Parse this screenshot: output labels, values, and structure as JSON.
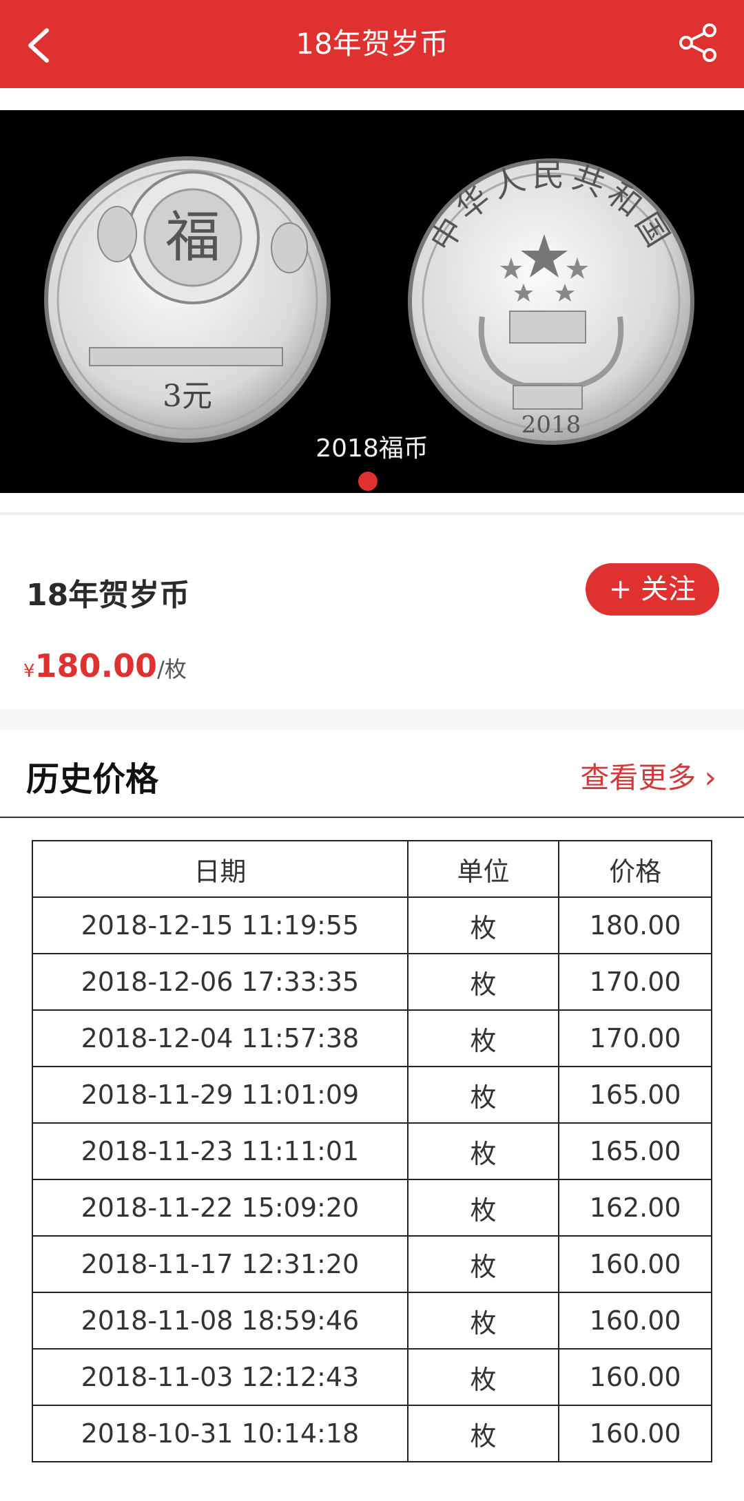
{
  "header": {
    "title": "18年贺岁币",
    "back_icon": "chevron-left-icon",
    "share_icon": "share-icon"
  },
  "banner": {
    "caption": "2018福币",
    "coin_front": {
      "fu_character": "福",
      "denomination": "3元"
    },
    "coin_back": {
      "inscription": "中华人民共和国",
      "year": "2018"
    }
  },
  "product": {
    "name": "18年贺岁币",
    "follow_label": "+ 关注",
    "currency": "¥",
    "price": "180.00",
    "unit": "/枚"
  },
  "history": {
    "title": "历史价格",
    "more_label": "查看更多",
    "columns": [
      "日期",
      "单位",
      "价格"
    ],
    "rows": [
      {
        "date": "2018-12-15 11:19:55",
        "unit": "枚",
        "price": "180.00"
      },
      {
        "date": "2018-12-06 17:33:35",
        "unit": "枚",
        "price": "170.00"
      },
      {
        "date": "2018-12-04 11:57:38",
        "unit": "枚",
        "price": "170.00"
      },
      {
        "date": "2018-11-29 11:01:09",
        "unit": "枚",
        "price": "165.00"
      },
      {
        "date": "2018-11-23 11:11:01",
        "unit": "枚",
        "price": "165.00"
      },
      {
        "date": "2018-11-22 15:09:20",
        "unit": "枚",
        "price": "162.00"
      },
      {
        "date": "2018-11-17 12:31:20",
        "unit": "枚",
        "price": "160.00"
      },
      {
        "date": "2018-11-08 18:59:46",
        "unit": "枚",
        "price": "160.00"
      },
      {
        "date": "2018-11-03 12:12:43",
        "unit": "枚",
        "price": "160.00"
      },
      {
        "date": "2018-10-31 10:14:18",
        "unit": "枚",
        "price": "160.00"
      }
    ]
  },
  "colors": {
    "accent": "#e03131",
    "banner_bg": "#000000"
  }
}
